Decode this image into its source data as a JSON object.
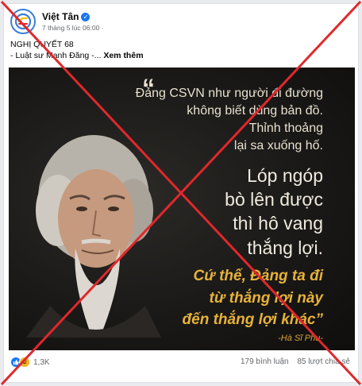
{
  "post": {
    "page_name": "Việt Tân",
    "timestamp": "7 tháng 5 lúc 06:00",
    "text_line1": "NGHỊ QUYẾT 68",
    "text_line2": "- Luật sư Mạnh Đăng -...",
    "see_more": "Xem thêm"
  },
  "image": {
    "quote_mark": "“",
    "lines": [
      "Đảng CSVN như người đi đường",
      "không biết dùng bản đồ.",
      "Thỉnh thoảng",
      "lại sa xuống hố.",
      "Lóp ngóp",
      "bò lên được",
      "thì hô vang",
      "thắng lợi.",
      "Cứ thế, Đảng ta đi",
      "từ thắng lợi này",
      "đến thắng lợi khác”"
    ],
    "author": "-Hà Sĩ Phu-"
  },
  "footer": {
    "reaction_count": "1,3K",
    "comments": "179 bình luận",
    "shares": "85 lượt chia sẻ"
  },
  "colors": {
    "cross": "#e0282c",
    "accent_quote": "#e8b23a",
    "brand": "#1877f2"
  },
  "icons": [
    "viettan-logo-icon",
    "verified-icon",
    "more-options-icon",
    "like-reaction-icon",
    "haha-reaction-icon"
  ]
}
